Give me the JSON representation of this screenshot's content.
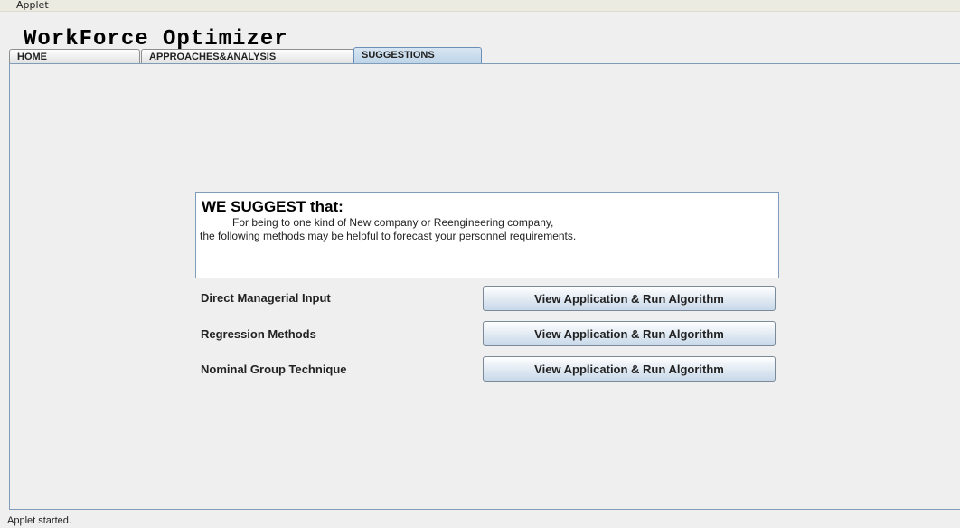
{
  "window": {
    "title": "Applet"
  },
  "app": {
    "title": "WorkForce Optimizer"
  },
  "tabs": [
    {
      "label": "HOME"
    },
    {
      "label": "APPROACHES&ANALYSIS"
    },
    {
      "label": "SUGGESTIONS"
    }
  ],
  "suggestion": {
    "heading": "WE SUGGEST that:",
    "line1": "For being to  one kind of   New company or Reengineering company,",
    "line2": "the following methods may be helpful to forecast your personnel requirements."
  },
  "methods": [
    {
      "label": "Direct Managerial Input",
      "button": "View Application & Run Algorithm"
    },
    {
      "label": "Regression Methods",
      "button": "View Application & Run Algorithm"
    },
    {
      "label": "Nominal Group Technique",
      "button": "View Application & Run Algorithm"
    }
  ],
  "status": {
    "text": "Applet started."
  }
}
